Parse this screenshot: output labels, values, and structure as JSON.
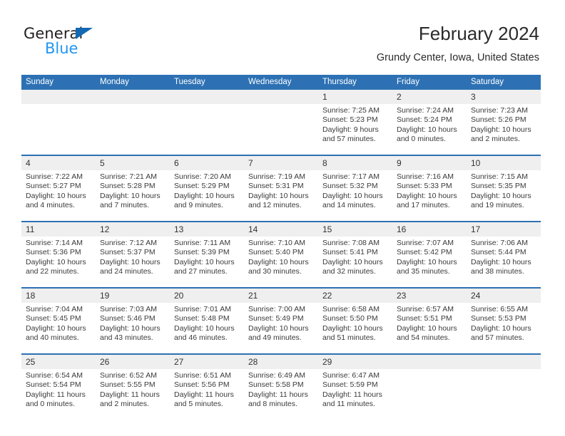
{
  "brand": {
    "name_part1": "General",
    "name_part2": "Blue",
    "accent_color": "#1268b3",
    "accent_color_light": "#2196f3"
  },
  "header": {
    "title": "February 2024",
    "subtitle": "Grundy Center, Iowa, United States"
  },
  "calendar": {
    "header_bg": "#2d71b4",
    "daynum_bg": "#efefef",
    "weekdays": [
      "Sunday",
      "Monday",
      "Tuesday",
      "Wednesday",
      "Thursday",
      "Friday",
      "Saturday"
    ],
    "weeks": [
      [
        {
          "day": "",
          "lines": []
        },
        {
          "day": "",
          "lines": []
        },
        {
          "day": "",
          "lines": []
        },
        {
          "day": "",
          "lines": []
        },
        {
          "day": "1",
          "lines": [
            "Sunrise: 7:25 AM",
            "Sunset: 5:23 PM",
            "Daylight: 9 hours",
            "and 57 minutes."
          ]
        },
        {
          "day": "2",
          "lines": [
            "Sunrise: 7:24 AM",
            "Sunset: 5:24 PM",
            "Daylight: 10 hours",
            "and 0 minutes."
          ]
        },
        {
          "day": "3",
          "lines": [
            "Sunrise: 7:23 AM",
            "Sunset: 5:26 PM",
            "Daylight: 10 hours",
            "and 2 minutes."
          ]
        }
      ],
      [
        {
          "day": "4",
          "lines": [
            "Sunrise: 7:22 AM",
            "Sunset: 5:27 PM",
            "Daylight: 10 hours",
            "and 4 minutes."
          ]
        },
        {
          "day": "5",
          "lines": [
            "Sunrise: 7:21 AM",
            "Sunset: 5:28 PM",
            "Daylight: 10 hours",
            "and 7 minutes."
          ]
        },
        {
          "day": "6",
          "lines": [
            "Sunrise: 7:20 AM",
            "Sunset: 5:29 PM",
            "Daylight: 10 hours",
            "and 9 minutes."
          ]
        },
        {
          "day": "7",
          "lines": [
            "Sunrise: 7:19 AM",
            "Sunset: 5:31 PM",
            "Daylight: 10 hours",
            "and 12 minutes."
          ]
        },
        {
          "day": "8",
          "lines": [
            "Sunrise: 7:17 AM",
            "Sunset: 5:32 PM",
            "Daylight: 10 hours",
            "and 14 minutes."
          ]
        },
        {
          "day": "9",
          "lines": [
            "Sunrise: 7:16 AM",
            "Sunset: 5:33 PM",
            "Daylight: 10 hours",
            "and 17 minutes."
          ]
        },
        {
          "day": "10",
          "lines": [
            "Sunrise: 7:15 AM",
            "Sunset: 5:35 PM",
            "Daylight: 10 hours",
            "and 19 minutes."
          ]
        }
      ],
      [
        {
          "day": "11",
          "lines": [
            "Sunrise: 7:14 AM",
            "Sunset: 5:36 PM",
            "Daylight: 10 hours",
            "and 22 minutes."
          ]
        },
        {
          "day": "12",
          "lines": [
            "Sunrise: 7:12 AM",
            "Sunset: 5:37 PM",
            "Daylight: 10 hours",
            "and 24 minutes."
          ]
        },
        {
          "day": "13",
          "lines": [
            "Sunrise: 7:11 AM",
            "Sunset: 5:39 PM",
            "Daylight: 10 hours",
            "and 27 minutes."
          ]
        },
        {
          "day": "14",
          "lines": [
            "Sunrise: 7:10 AM",
            "Sunset: 5:40 PM",
            "Daylight: 10 hours",
            "and 30 minutes."
          ]
        },
        {
          "day": "15",
          "lines": [
            "Sunrise: 7:08 AM",
            "Sunset: 5:41 PM",
            "Daylight: 10 hours",
            "and 32 minutes."
          ]
        },
        {
          "day": "16",
          "lines": [
            "Sunrise: 7:07 AM",
            "Sunset: 5:42 PM",
            "Daylight: 10 hours",
            "and 35 minutes."
          ]
        },
        {
          "day": "17",
          "lines": [
            "Sunrise: 7:06 AM",
            "Sunset: 5:44 PM",
            "Daylight: 10 hours",
            "and 38 minutes."
          ]
        }
      ],
      [
        {
          "day": "18",
          "lines": [
            "Sunrise: 7:04 AM",
            "Sunset: 5:45 PM",
            "Daylight: 10 hours",
            "and 40 minutes."
          ]
        },
        {
          "day": "19",
          "lines": [
            "Sunrise: 7:03 AM",
            "Sunset: 5:46 PM",
            "Daylight: 10 hours",
            "and 43 minutes."
          ]
        },
        {
          "day": "20",
          "lines": [
            "Sunrise: 7:01 AM",
            "Sunset: 5:48 PM",
            "Daylight: 10 hours",
            "and 46 minutes."
          ]
        },
        {
          "day": "21",
          "lines": [
            "Sunrise: 7:00 AM",
            "Sunset: 5:49 PM",
            "Daylight: 10 hours",
            "and 49 minutes."
          ]
        },
        {
          "day": "22",
          "lines": [
            "Sunrise: 6:58 AM",
            "Sunset: 5:50 PM",
            "Daylight: 10 hours",
            "and 51 minutes."
          ]
        },
        {
          "day": "23",
          "lines": [
            "Sunrise: 6:57 AM",
            "Sunset: 5:51 PM",
            "Daylight: 10 hours",
            "and 54 minutes."
          ]
        },
        {
          "day": "24",
          "lines": [
            "Sunrise: 6:55 AM",
            "Sunset: 5:53 PM",
            "Daylight: 10 hours",
            "and 57 minutes."
          ]
        }
      ],
      [
        {
          "day": "25",
          "lines": [
            "Sunrise: 6:54 AM",
            "Sunset: 5:54 PM",
            "Daylight: 11 hours",
            "and 0 minutes."
          ]
        },
        {
          "day": "26",
          "lines": [
            "Sunrise: 6:52 AM",
            "Sunset: 5:55 PM",
            "Daylight: 11 hours",
            "and 2 minutes."
          ]
        },
        {
          "day": "27",
          "lines": [
            "Sunrise: 6:51 AM",
            "Sunset: 5:56 PM",
            "Daylight: 11 hours",
            "and 5 minutes."
          ]
        },
        {
          "day": "28",
          "lines": [
            "Sunrise: 6:49 AM",
            "Sunset: 5:58 PM",
            "Daylight: 11 hours",
            "and 8 minutes."
          ]
        },
        {
          "day": "29",
          "lines": [
            "Sunrise: 6:47 AM",
            "Sunset: 5:59 PM",
            "Daylight: 11 hours",
            "and 11 minutes."
          ]
        },
        {
          "day": "",
          "lines": []
        },
        {
          "day": "",
          "lines": []
        }
      ]
    ]
  }
}
